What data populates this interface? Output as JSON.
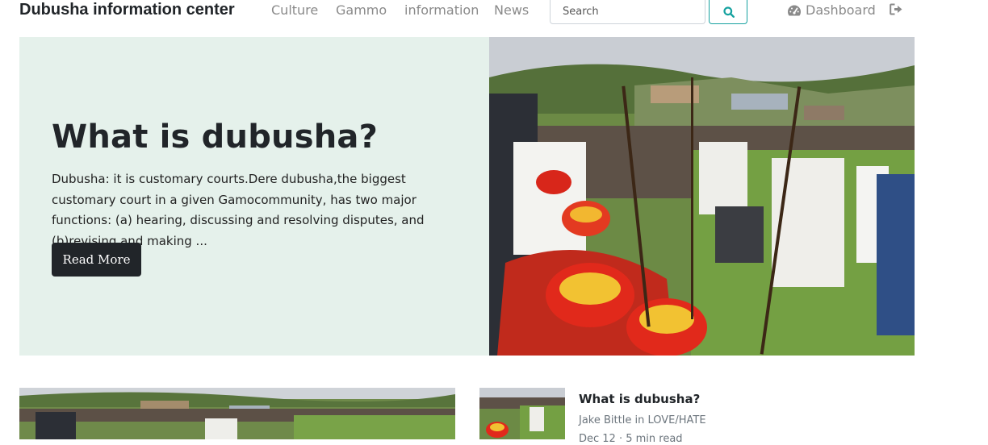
{
  "navbar": {
    "brand": "Dubusha information center",
    "links": [
      "Culture",
      "Gammo",
      "information",
      "News"
    ],
    "search_placeholder": "Search",
    "dashboard_label": "Dashboard"
  },
  "hero": {
    "title": "What is dubusha?",
    "text": "Dubusha: it is customary courts.Dere dubusha,the biggest customary court in a given Gamocommunity, has two major functions: (a) hearing, discussing and resolving disputes, and (b)revising and making ...",
    "read_more_label": "Read More"
  },
  "side_post": {
    "title": "What is dubusha?",
    "meta": "Jake Bittle in LOVE/HATE",
    "date": "Dec 12 · 5 min read"
  },
  "colors": {
    "hero_bg": "#e5f1eb",
    "search_accent": "#17a2a0",
    "button_dark": "#212529"
  }
}
